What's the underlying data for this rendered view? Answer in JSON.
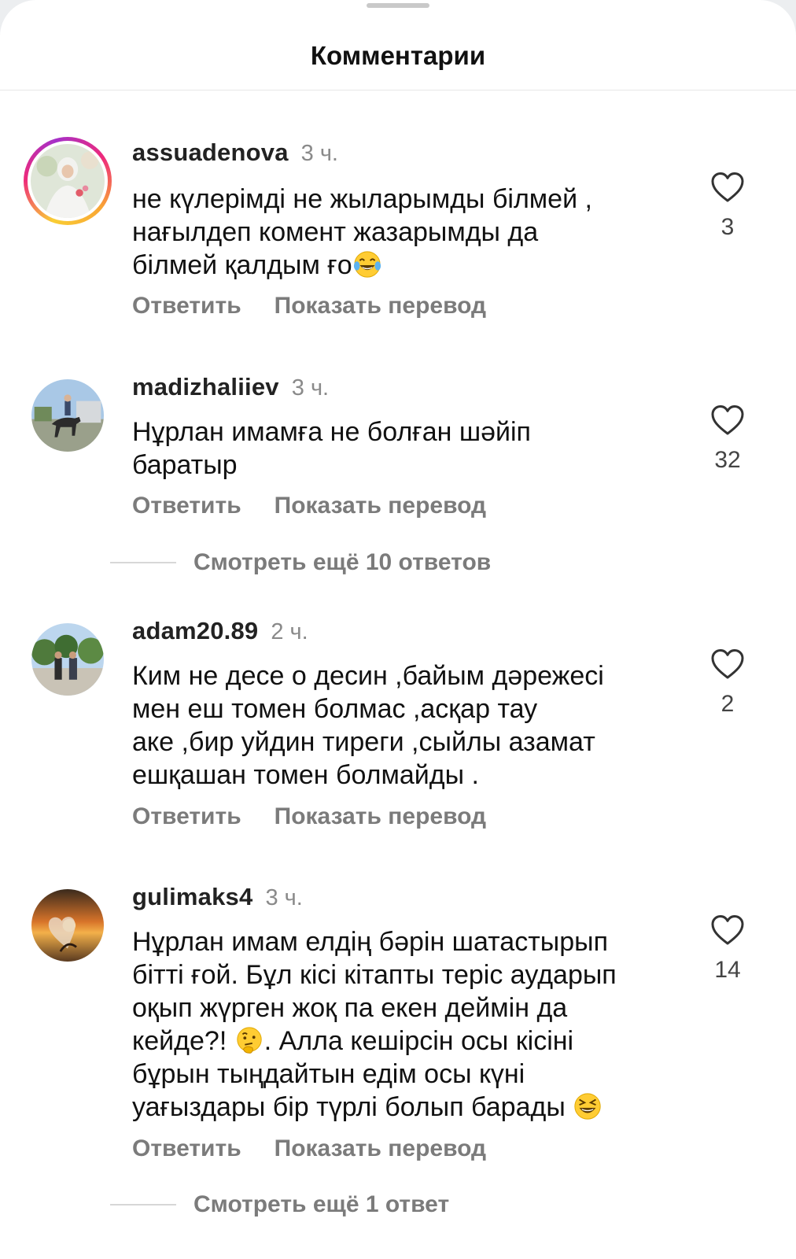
{
  "header": {
    "title": "Комментарии"
  },
  "comments": [
    {
      "username": "assuadenova",
      "time": "3 ч.",
      "lines": [
        "не күлерімді не жыларымды білмей ,",
        "нағылдеп комент жазарымды да",
        "білмей қалдым ғо"
      ],
      "emoji": "tears-of-joy",
      "likes": "3",
      "reply_label": "Ответить",
      "translate_label": "Показать перевод"
    },
    {
      "username": "madizhaliiev",
      "time": "3 ч.",
      "lines": [
        "Нұрлан имамға не болған шәйіп",
        "баратыр"
      ],
      "likes": "32",
      "reply_label": "Ответить",
      "translate_label": "Показать перевод",
      "more_replies": "Смотреть ещё 10 ответов"
    },
    {
      "username": "adam20.89",
      "time": "2 ч.",
      "lines": [
        "Ким не десе о десин ,байым дәрежесі",
        "мен еш томен болмас ,асқар тау",
        "аке ,бир уйдин тиреги ,сыйлы азамат",
        "ешқашан томен болмайды ."
      ],
      "likes": "2",
      "reply_label": "Ответить",
      "translate_label": "Показать перевод"
    },
    {
      "username": "gulimaks4",
      "time": "3 ч.",
      "lines": [
        "Нұрлан имам елдің бәрін шатастырып",
        "бітті ғой. Бұл кісі кітапты теріс аударып",
        "оқып жүрген жоқ па екен деймін да",
        "кейде?!",
        ". Алла кешірсін осы кісіні",
        "бұрын тыңдайтын едім осы күні",
        "уағыздары бір түрлі болып барады"
      ],
      "emoji_a": "thinking-face",
      "emoji_b": "grinning-squinting-face",
      "likes": "14",
      "reply_label": "Ответить",
      "translate_label": "Показать перевод",
      "more_replies": "Смотреть ещё 1 ответ"
    }
  ]
}
